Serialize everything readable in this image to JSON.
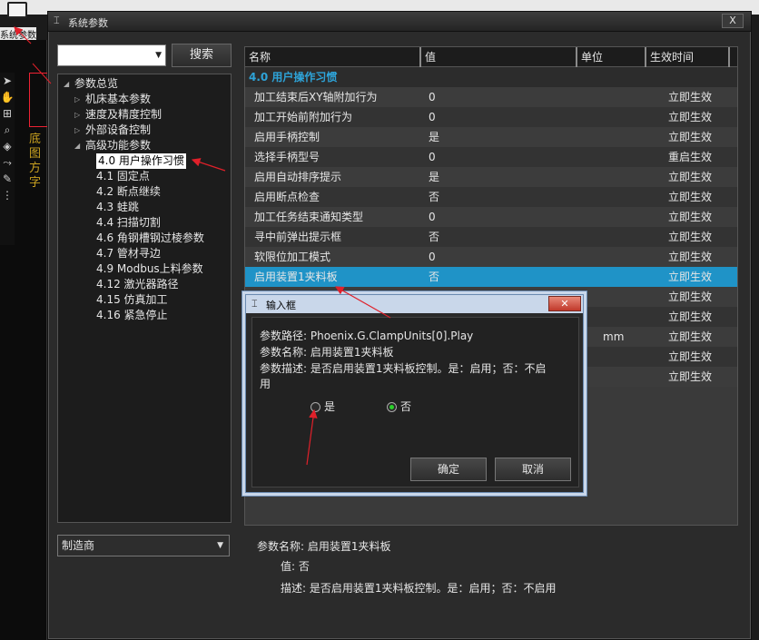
{
  "toolbar": {
    "sys_params_label": "系统参数"
  },
  "window": {
    "title": "系统参数",
    "close": "X"
  },
  "left": {
    "search_value": "",
    "search_button": "搜索",
    "tree": [
      {
        "label": "参数总览",
        "level": 0,
        "arrow": "open"
      },
      {
        "label": "机床基本参数",
        "level": 1,
        "arrow": "closed"
      },
      {
        "label": "速度及精度控制",
        "level": 1,
        "arrow": "closed"
      },
      {
        "label": "外部设备控制",
        "level": 1,
        "arrow": "closed"
      },
      {
        "label": "高级功能参数",
        "level": 1,
        "arrow": "open"
      },
      {
        "label": "4.0 用户操作习惯",
        "level": 2,
        "selected": true
      },
      {
        "label": "4.1 固定点",
        "level": 2
      },
      {
        "label": "4.2 断点继续",
        "level": 2
      },
      {
        "label": "4.3 蛙跳",
        "level": 2
      },
      {
        "label": "4.4 扫描切割",
        "level": 2
      },
      {
        "label": "4.6 角钢槽钢过棱参数",
        "level": 2
      },
      {
        "label": "4.7 管材寻边",
        "level": 2
      },
      {
        "label": "4.9 Modbus上料参数",
        "level": 2
      },
      {
        "label": "4.12 激光器路径",
        "level": 2
      },
      {
        "label": "4.15 仿真加工",
        "level": 2
      },
      {
        "label": "4.16 紧急停止",
        "level": 2
      }
    ],
    "dropdown": "制造商"
  },
  "grid": {
    "headers": {
      "name": "名称",
      "value": "值",
      "unit": "单位",
      "effect": "生效时间"
    },
    "group": "4.0 用户操作习惯",
    "rows": [
      {
        "name": "加工结束后XY轴附加行为",
        "value": "0",
        "unit": "",
        "effect": "立即生效"
      },
      {
        "name": "加工开始前附加行为",
        "value": "0",
        "unit": "",
        "effect": "立即生效"
      },
      {
        "name": "启用手柄控制",
        "value": "是",
        "unit": "",
        "effect": "立即生效"
      },
      {
        "name": "选择手柄型号",
        "value": "0",
        "unit": "",
        "effect": "重启生效"
      },
      {
        "name": "启用自动排序提示",
        "value": "是",
        "unit": "",
        "effect": "立即生效"
      },
      {
        "name": "启用断点检查",
        "value": "否",
        "unit": "",
        "effect": "立即生效"
      },
      {
        "name": "加工任务结束通知类型",
        "value": "0",
        "unit": "",
        "effect": "立即生效"
      },
      {
        "name": "寻中前弹出提示框",
        "value": "否",
        "unit": "",
        "effect": "立即生效"
      },
      {
        "name": "软限位加工模式",
        "value": "0",
        "unit": "",
        "effect": "立即生效"
      },
      {
        "name": "启用装置1夹料板",
        "value": "否",
        "unit": "",
        "effect": "立即生效",
        "selected": true
      },
      {
        "name": "",
        "value": "",
        "unit": "",
        "effect": "立即生效"
      },
      {
        "name": "",
        "value": "",
        "unit": "",
        "effect": "立即生效"
      },
      {
        "name": "",
        "value": "",
        "unit": "mm",
        "effect": "立即生效"
      },
      {
        "name": "",
        "value": "",
        "unit": "",
        "effect": "立即生效"
      },
      {
        "name": "",
        "value": "",
        "unit": "",
        "effect": "立即生效"
      }
    ]
  },
  "description": {
    "name_line": "参数名称: 启用装置1夹料板",
    "value_line": "值: 否",
    "desc_line": "描述: 是否启用装置1夹料板控制。是：启用；否：不启用"
  },
  "dialog": {
    "title": "输入框",
    "path": "参数路径: Phoenix.G.ClampUnits[0].Play",
    "name": "参数名称: 启用装置1夹料板",
    "desc1": "参数描述: 是否启用装置1夹料板控制。是：启用；否：不启",
    "desc2": "用",
    "option_yes": "是",
    "option_no": "否",
    "selected_option": "否",
    "ok": "确定",
    "cancel": "取消"
  },
  "background": {
    "yellow_text": "底图方字"
  },
  "colors": {
    "accent": "#1f93c7",
    "group_text": "#2ea3d8",
    "radio_on": "#2bd02b",
    "annotation": "#e0202a"
  }
}
